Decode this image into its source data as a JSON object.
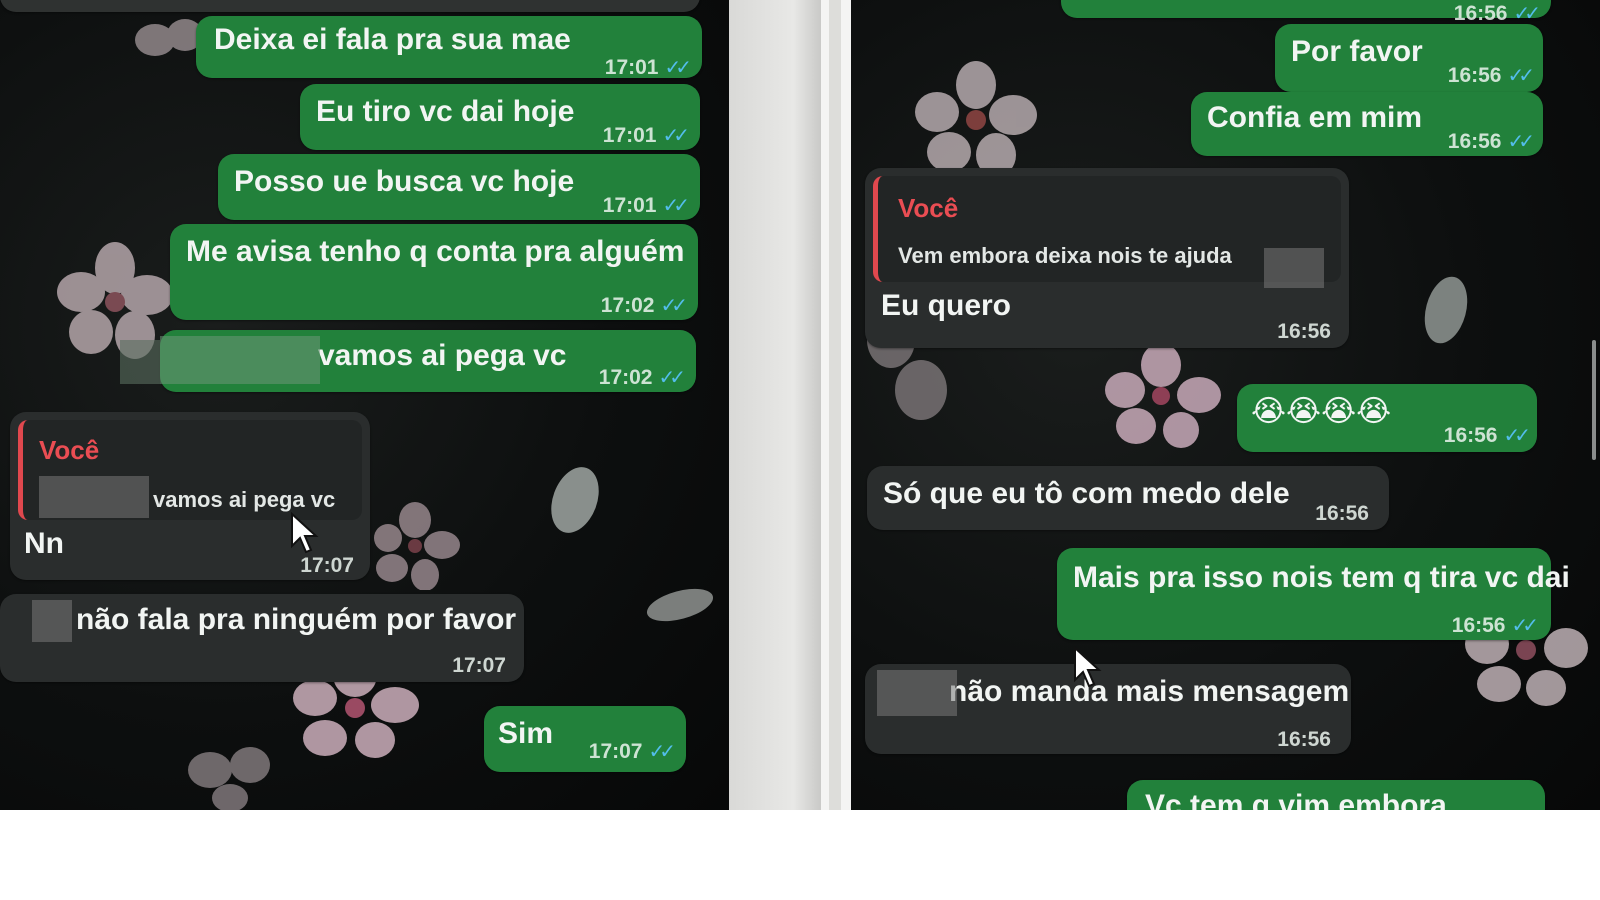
{
  "left_chat": {
    "messages": [
      {
        "text": "Deixa ei fala pra sua mae",
        "time": "17:01"
      },
      {
        "text": "Eu tiro vc dai hoje",
        "time": "17:01"
      },
      {
        "text": "Posso ue busca vc hoje",
        "time": "17:01"
      },
      {
        "text": "Me avisa tenho q conta pra alguém",
        "time": "17:02"
      },
      {
        "text": "vamos ai pega vc",
        "time": "17:02"
      },
      {
        "reply_author": "Você",
        "reply_quote": "vamos ai pega vc",
        "text": "Nn",
        "time": "17:07"
      },
      {
        "text": "não fala pra ninguém por favor",
        "time": "17:07"
      },
      {
        "text": "Sim",
        "time": "17:07"
      }
    ]
  },
  "right_chat": {
    "messages": [
      {
        "time": "16:56"
      },
      {
        "text": "Por favor",
        "time": "16:56"
      },
      {
        "text": "Confia em mim",
        "time": "16:56"
      },
      {
        "reply_author": "Você",
        "reply_quote": "Vem embora deixa nois te ajuda",
        "text": "Eu quero",
        "time": "16:56"
      },
      {
        "text": "😭😭😭😭",
        "time": "16:56"
      },
      {
        "text": "Só que eu tô com medo dele",
        "time": "16:56"
      },
      {
        "text": "Mais pra isso nois tem q tira vc dai",
        "time": "16:56"
      },
      {
        "text": "não manda mais mensagem",
        "time": "16:56"
      },
      {
        "text": "Vc tem q vim embora"
      }
    ]
  },
  "icons": {
    "read_receipt": "double-check-icon",
    "pointer": "mouse-cursor-icon",
    "wallpaper": "cherry-blossom-icon"
  },
  "colors": {
    "outgoing_bubble": "#22813b",
    "incoming_bubble": "#2a2d2d",
    "reply_accent": "#e0484e",
    "read_ticks": "#53bdeb",
    "chat_background": "#0d0f0f"
  }
}
